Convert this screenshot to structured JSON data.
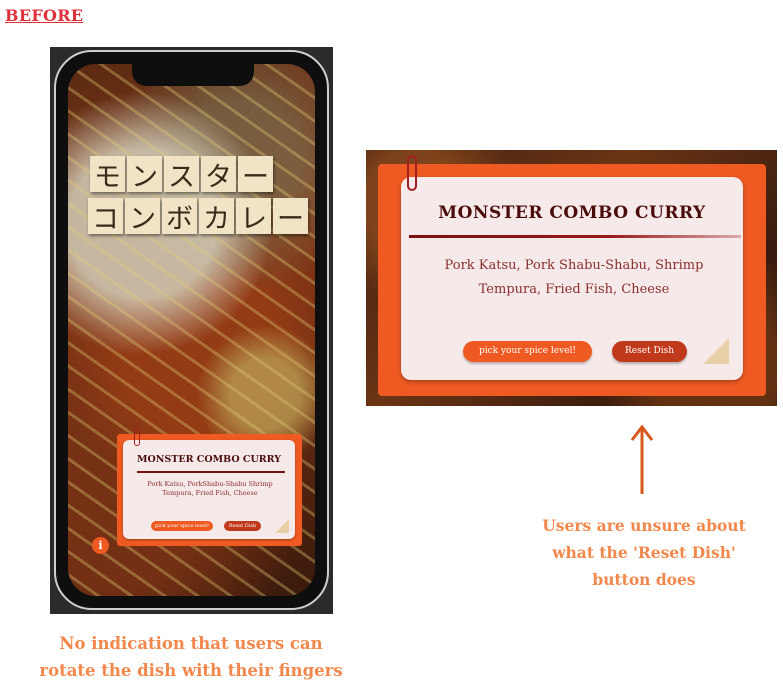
{
  "heading": "BEFORE",
  "phone": {
    "jp_title_line1": [
      "モ",
      "ン",
      "ス",
      "タ",
      "ー"
    ],
    "jp_title_line2": [
      "コ",
      "ン",
      "ボ",
      "カ",
      "レ",
      "ー"
    ],
    "card": {
      "title": "MONSTER COMBO CURRY",
      "ingredients_line1": "Pork Katsu, PorkShabu-Shabu Shrimp",
      "ingredients_line2": "Tempura, Fried Fish, Cheese",
      "spice_button": "pick your spice level!",
      "reset_button": "Reset Dish"
    },
    "info_button": "i"
  },
  "zoomed_card": {
    "title": "MONSTER COMBO CURRY",
    "ingredients_line1": "Pork Katsu, Pork Shabu-Shabu, Shrimp",
    "ingredients_line2": "Tempura, Fried Fish, Cheese",
    "spice_button": "pick your spice level!",
    "reset_button": "Reset Dish"
  },
  "annotations": {
    "reset_note": [
      "Users are unsure about",
      "what the 'Reset Dish'",
      "button does"
    ],
    "rotate_note": [
      "No indication that users can",
      "rotate the dish with their fingers"
    ]
  },
  "colors": {
    "heading": "#e0313b",
    "card_orange": "#ef5a22",
    "reset_red": "#c0391b",
    "title_maroon": "#4a0b0b",
    "annotation": "#f2884b"
  },
  "icons": {
    "paperclip": "paperclip-icon",
    "info": "info-icon",
    "arrow": "arrow-up-icon"
  }
}
